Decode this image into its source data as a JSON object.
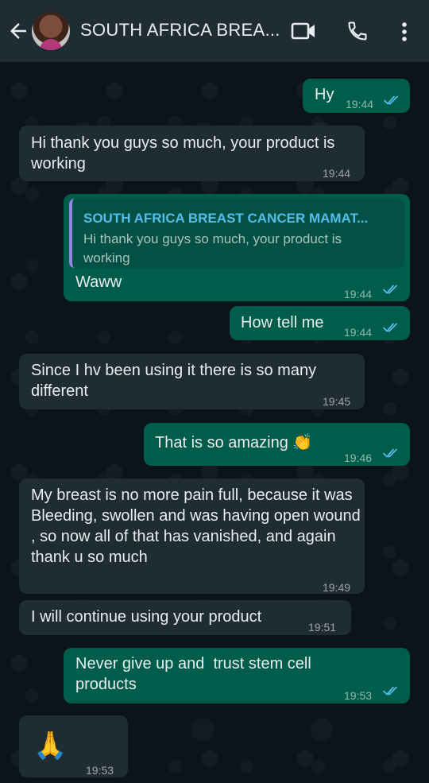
{
  "header": {
    "title": "SOUTH AFRICA BREA...",
    "icons": [
      "back-arrow-icon",
      "avatar",
      "video-call-icon",
      "voice-call-icon",
      "more-options-icon"
    ]
  },
  "messages": [
    {
      "dir": "out",
      "text": "Hy",
      "time": "19:44",
      "read": true
    },
    {
      "dir": "in",
      "text": "Hi thank you guys so much, your product is working",
      "time": "19:44"
    },
    {
      "dir": "out",
      "quote_author": "SOUTH AFRICA BREAST CANCER MAMAT...",
      "quote_text": "Hi thank you guys so much, your product is working",
      "text": "Waww",
      "time": "19:44",
      "read": true
    },
    {
      "dir": "out",
      "text": "How tell me",
      "time": "19:44",
      "read": true
    },
    {
      "dir": "in",
      "text": "Since I hv been using it there is so many different",
      "time": "19:45"
    },
    {
      "dir": "out",
      "text": "That is so amazing 👏",
      "time": "19:46",
      "read": true
    },
    {
      "dir": "in",
      "text": "My breast is no more pain full, because it was Bleeding, swollen and was having open wound , so now all of that has vanished, and again thank u so much",
      "time": "19:49"
    },
    {
      "dir": "in",
      "text": "I will continue using your product",
      "time": "19:51"
    },
    {
      "dir": "out",
      "text": "Never give up and  trust stem cell products",
      "time": "19:53",
      "read": true
    },
    {
      "dir": "in",
      "text": "🙏",
      "time": "19:53"
    }
  ],
  "colors": {
    "incoming": "#202c33",
    "outgoing": "#005c4b",
    "header": "#1f2c34",
    "read_ticks": "#53bdeb"
  }
}
